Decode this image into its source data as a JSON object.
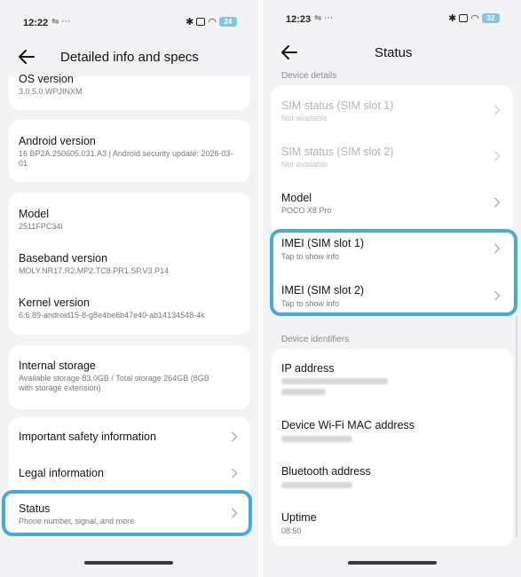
{
  "left": {
    "status_bar": {
      "time": "12:22",
      "extra_icons": "⇋ ⋯",
      "battery": "24"
    },
    "header": {
      "title": "Detailed info and specs"
    },
    "os": {
      "title": "OS version",
      "value": "3.0.5.0.WPJINXM"
    },
    "android": {
      "title": "Android version",
      "value": "16 BP2A.250605.031.A3 | Android security update: 2026-03-01"
    },
    "model": {
      "title": "Model",
      "value": "2511FPC34I"
    },
    "baseband": {
      "title": "Baseband version",
      "value": "MOLY.NR17.R2.MP2.TC8.PR1.SP.V3.P14"
    },
    "kernel": {
      "title": "Kernel version",
      "value": "6.6.89-android15-8-g8e4be6b47e40-ab14134548-4k"
    },
    "storage": {
      "title": "Internal storage",
      "value": "Available storage  83.0GB / Total storage  264GB (8GB with storage extension)"
    },
    "safety": {
      "title": "Important safety information"
    },
    "legal": {
      "title": "Legal information"
    },
    "status": {
      "title": "Status",
      "value": "Phone number, signal, and more"
    }
  },
  "right": {
    "status_bar": {
      "time": "12:23",
      "extra_icons": "⇋ ⋯",
      "battery": "32"
    },
    "header": {
      "title": "Status"
    },
    "device_details_label": "Device details",
    "sim1": {
      "title": "SIM status (SIM slot 1)",
      "value": "Not available"
    },
    "sim2": {
      "title": "SIM status (SIM slot 2)",
      "value": "Not available"
    },
    "model": {
      "title": "Model",
      "value": "POCO X8 Pro"
    },
    "imei1": {
      "title": "IMEI (SIM slot 1)",
      "value": "Tap to show info"
    },
    "imei2": {
      "title": "IMEI (SIM slot 2)",
      "value": "Tap to show info"
    },
    "device_identifiers_label": "Device identifiers",
    "ip": {
      "title": "IP address"
    },
    "wifi_mac": {
      "title": "Device Wi-Fi MAC address"
    },
    "bt": {
      "title": "Bluetooth address"
    },
    "uptime": {
      "title": "Uptime",
      "value": "08:50"
    }
  },
  "colors": {
    "highlight": "#4aaad6",
    "background": "#f3f3f5",
    "card": "#ffffff"
  },
  "icons": [
    "back-arrow-icon",
    "chevron-right-icon",
    "bluetooth-icon",
    "wifi-icon",
    "battery-icon"
  ]
}
